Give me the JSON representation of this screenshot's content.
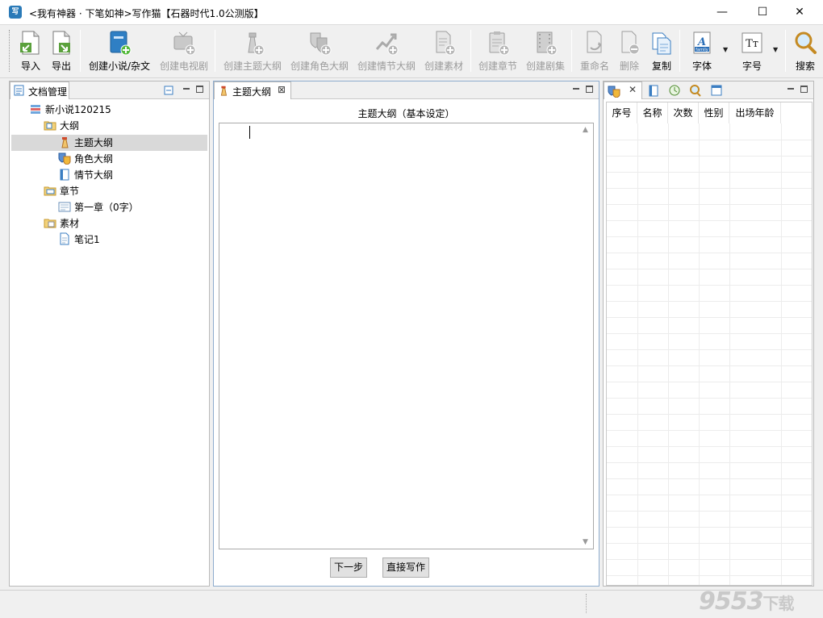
{
  "window": {
    "title": "<我有神器 · 下笔如神>写作猫【石器时代1.0公测版】",
    "controls": {
      "minimize": "—",
      "maximize": "☐",
      "close": "✕"
    }
  },
  "toolbar": {
    "import": "导入",
    "export": "导出",
    "create_novel": "创建小说/杂文",
    "create_tv": "创建电视剧",
    "create_theme_outline": "创建主题大纲",
    "create_role_outline": "创建角色大纲",
    "create_plot_outline": "创建情节大纲",
    "create_material": "创建素材",
    "create_chapter": "创建章节",
    "create_episode": "创建剧集",
    "rename": "重命名",
    "delete": "删除",
    "copy": "复制",
    "font": "字体",
    "font_size": "字号",
    "search": "搜索"
  },
  "left_panel": {
    "tab_label": "文档管理",
    "tree": {
      "root": "新小说120215",
      "outline": "大纲",
      "theme_outline": "主题大纲",
      "role_outline": "角色大纲",
      "plot_outline": "情节大纲",
      "chapters": "章节",
      "chapter1": "第一章（0字）",
      "materials": "素材",
      "note1": "笔记1"
    }
  },
  "center_panel": {
    "tab_label": "主题大纲",
    "tab_close": "⊠",
    "heading": "主题大纲（基本设定）",
    "content": "",
    "next_button": "下一步",
    "write_button": "直接写作"
  },
  "right_panel": {
    "columns": [
      "序号",
      "名称",
      "次数",
      "性别",
      "出场年龄"
    ]
  },
  "watermark": {
    "main": "9553",
    "sub": "下载"
  },
  "colors": {
    "accent": "#2a7ab8",
    "selection": "#d9d9d9",
    "disabled_text": "#9a9a9a"
  }
}
